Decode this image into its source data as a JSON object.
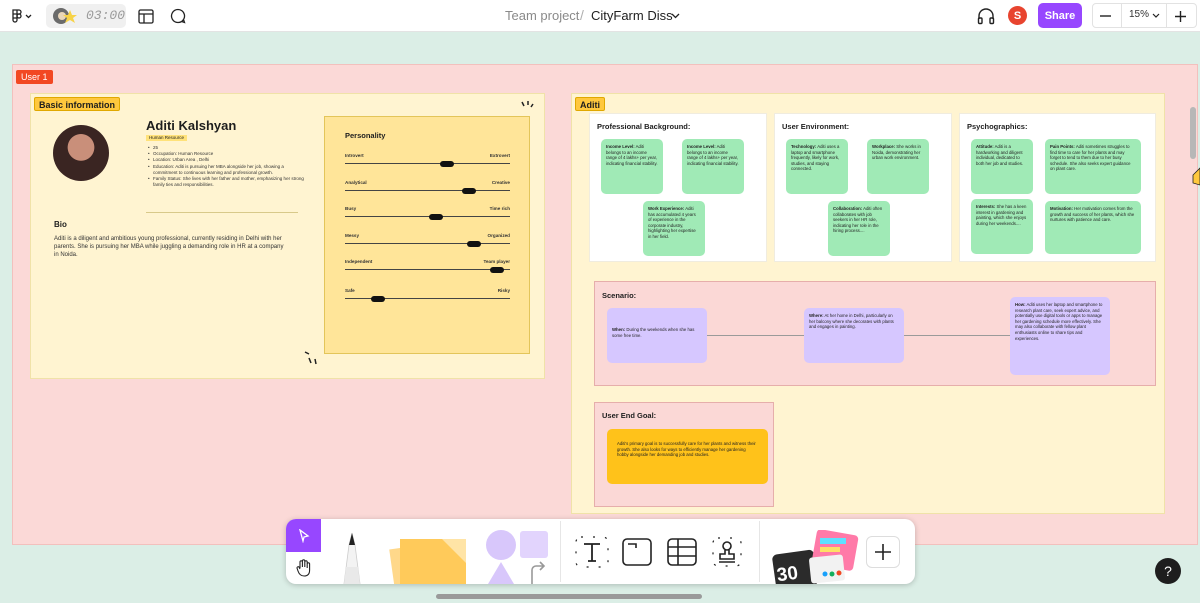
{
  "topbar": {
    "timer": "03:00",
    "breadcrumb": {
      "team": "Team project",
      "separator": "/",
      "file": "CityFarm Diss"
    },
    "avatar_initial": "S",
    "share_label": "Share",
    "zoom": "15%",
    "share_color": "#9747ff"
  },
  "canvas": {
    "section_label": "User 1",
    "basic": {
      "tag": "Basic information",
      "name": "Aditi Kalshyan",
      "role": "Human Resource",
      "details": [
        "25",
        "Occupation: Human Resource",
        "Location: Urban Area , Delhi",
        "Education: Aditi is pursuing her MBA alongside her job, showing a commitment to continuous learning and professional growth.",
        "Family Status: She lives with her father and mother, emphasizing her strong family ties and responsibilities."
      ],
      "bio_heading": "Bio",
      "bio_text": "Aditi is a diligent and ambitious young professional, currently residing in Delhi with her parents. She is pursuing her MBA while juggling a demanding role in HR at a company in Noida.",
      "personality": {
        "title": "Personality",
        "traits": [
          {
            "left": "Introvert",
            "right": "Extrovert",
            "level": 0.62
          },
          {
            "left": "Analytical",
            "right": "Creative",
            "level": 0.75
          },
          {
            "left": "Busy",
            "right": "Time rich",
            "level": 0.55
          },
          {
            "left": "Messy",
            "right": "Organized",
            "level": 0.78
          },
          {
            "left": "Independent",
            "right": "Team player",
            "level": 0.92
          },
          {
            "left": "Safe",
            "right": "Risky",
            "level": 0.2
          }
        ]
      }
    },
    "aditi": {
      "tag": "Aditi",
      "professional": {
        "title": "Professional Background:",
        "cards": [
          {
            "label": "Income Level:",
            "text": "Aditi belongs to an income range of 4 lakhs+ per year, indicating financial stability."
          },
          {
            "label": "Income Level:",
            "text": "Aditi belongs to an income range of 4 lakhs+ per year, indicating financial stability."
          },
          {
            "label": "Work Experience:",
            "text": "Aditi has accumulated 4 years of experience in the corporate industry, highlighting her expertise in her field."
          }
        ]
      },
      "environment": {
        "title": "User Environment:",
        "cards": [
          {
            "label": "Technology:",
            "text": "Aditi uses a laptop and smartphone frequently, likely for work, studies, and staying connected."
          },
          {
            "label": "Workplace:",
            "text": "She works in Noida, demonstrating her urban work environment."
          },
          {
            "label": "Collaboration:",
            "text": "Aditi often collaborates with job seekers in her HR role, indicating her role in the hiring process...."
          }
        ]
      },
      "psychographics": {
        "title": "Psychographics:",
        "cards": [
          {
            "label": "Attitude:",
            "text": "Aditi is a hardworking and diligent individual, dedicated to both her job and studies."
          },
          {
            "label": "Pain Points:",
            "text": "Aditi sometimes struggles to find time to care for her plants and may forget to tend to them due to her busy schedule. She also seeks expert guidance on plant care."
          },
          {
            "label": "Interests:",
            "text": "She has a keen interest in gardening and painting, which she enjoys during her weekends...."
          },
          {
            "label": "Motivation:",
            "text": "Her motivation comes from the growth and success of her plants, which she nurtures with patience and care."
          }
        ]
      },
      "scenario": {
        "title": "Scenario:",
        "cards": [
          {
            "label": "When:",
            "text": "During the weekends when she has some free time."
          },
          {
            "label": "Where:",
            "text": "At her home in Delhi, particularly on her balcony where she decorates with plants and engages in painting."
          },
          {
            "label": "How:",
            "text": "Aditi uses her laptop and smartphone to research plant care, seek expert advice, and potentially use digital tools or apps to manage her gardening schedule more effectively. She may also collaborate with fellow plant enthusiasts online to share tips and experiences."
          }
        ]
      },
      "goal": {
        "title": "User End Goal:",
        "text": "Aditi's primary goal is to successfully care for her plants and witness their growth. She also looks for ways to efficiently manage her gardening hobby alongside her demanding job and studies."
      }
    }
  },
  "toolbar": {
    "tools": [
      "select-tool",
      "hand-tool",
      "pen-tool",
      "sticky-note-tool",
      "shapes-tool",
      "text-tool",
      "section-tool",
      "table-tool",
      "stamp-tool",
      "widgets-tool",
      "more-tool"
    ],
    "widget_badge": "30"
  },
  "help_label": "?"
}
